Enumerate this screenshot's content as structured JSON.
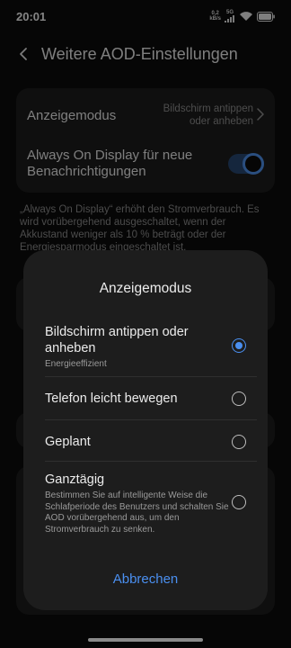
{
  "status": {
    "time": "20:01",
    "net_speed_value": "0,2",
    "net_speed_unit": "kB/s",
    "network": "5G",
    "icons": [
      "signal-icon",
      "wifi-icon",
      "battery-icon"
    ]
  },
  "header": {
    "title": "Weitere AOD-Einstellungen",
    "back_icon": "back-arrow-icon"
  },
  "settings": {
    "mode_label": "Anzeigemodus",
    "mode_value": "Bildschirm antippen oder anheben",
    "aod_label": "Always On Display für neue Benachrichtigungen",
    "aod_enabled": true,
    "description": "„Always On Display“ erhöht den Stromverbrauch. Es wird vorübergehend ausgeschaltet, wenn der Akkustand weniger als 10 % beträgt oder der Energiesparmodus eingeschaltet ist."
  },
  "dialog": {
    "title": "Anzeigemodus",
    "options": [
      {
        "label": "Bildschirm antippen oder anheben",
        "sub": "Energieeffizient",
        "selected": true
      },
      {
        "label": "Telefon leicht bewegen",
        "sub": "",
        "selected": false
      },
      {
        "label": "Geplant",
        "sub": "",
        "selected": false
      },
      {
        "label": "Ganztägig",
        "sub": "Bestimmen Sie auf intelligente Weise die Schlafperiode des Benutzers und schalten Sie AOD vorübergehend aus, um den Stromverbrauch zu senken.",
        "selected": false
      }
    ],
    "cancel_label": "Abbrechen"
  },
  "colors": {
    "accent": "#4a8ff0",
    "background": "#0b0b0b",
    "dialog": "#1d1d1d"
  }
}
